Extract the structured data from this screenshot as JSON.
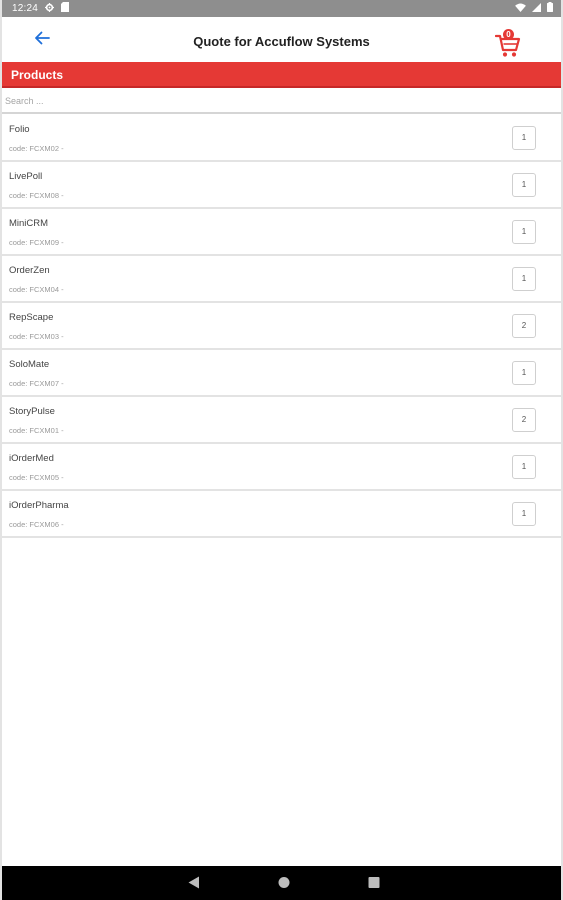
{
  "status_bar": {
    "time": "12:24",
    "icons": [
      "gear-icon",
      "sd-card-icon",
      "wifi-icon",
      "signal-icon",
      "battery-icon"
    ]
  },
  "header": {
    "title": "Quote for Accuflow Systems",
    "back_icon": "arrow-left-icon",
    "cart_icon": "cart-icon",
    "cart_badge": "0",
    "accent_color": "#1e6fd9",
    "cart_color": "#e53935"
  },
  "section": {
    "title": "Products",
    "color": "#e53935"
  },
  "search": {
    "placeholder": "Search ...",
    "value": ""
  },
  "products": [
    {
      "name": "Folio",
      "code": "code: FCXM02 -",
      "qty": "1"
    },
    {
      "name": "LivePoll",
      "code": "code: FCXM08 -",
      "qty": "1"
    },
    {
      "name": "MiniCRM",
      "code": "code: FCXM09 -",
      "qty": "1"
    },
    {
      "name": "OrderZen",
      "code": "code: FCXM04 -",
      "qty": "1"
    },
    {
      "name": "RepScape",
      "code": "code: FCXM03 -",
      "qty": "2"
    },
    {
      "name": "SoloMate",
      "code": "code: FCXM07 -",
      "qty": "1"
    },
    {
      "name": "StoryPulse",
      "code": "code: FCXM01 -",
      "qty": "2"
    },
    {
      "name": "iOrderMed",
      "code": "code: FCXM05 -",
      "qty": "1"
    },
    {
      "name": "iOrderPharma",
      "code": "code: FCXM06 -",
      "qty": "1"
    }
  ],
  "nav_bar": {
    "icons": [
      "back-triangle-icon",
      "home-circle-icon",
      "recents-square-icon"
    ]
  }
}
